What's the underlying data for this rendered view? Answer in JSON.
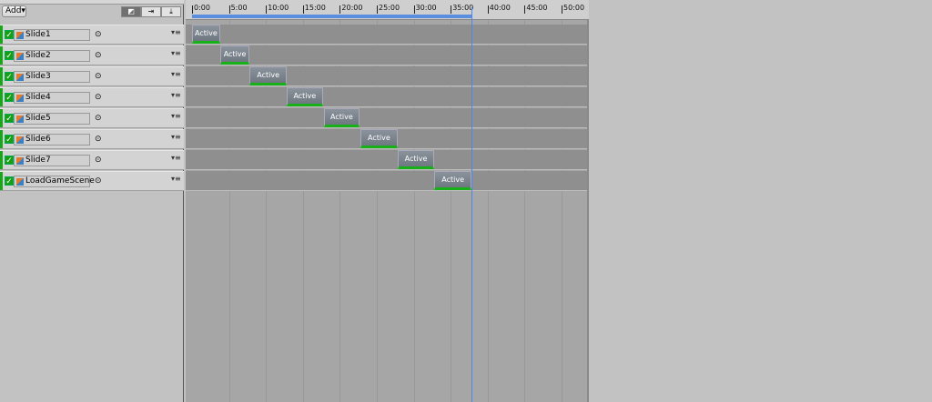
{
  "toolbar": {
    "add_label": "Add▾",
    "modes": [
      "◩",
      "⇥",
      "⤓"
    ]
  },
  "tracks": [
    {
      "name": "Slide1",
      "clip": "Active",
      "start": 0,
      "end": 3.8
    },
    {
      "name": "Slide2",
      "clip": "Active",
      "start": 3.8,
      "end": 7.8
    },
    {
      "name": "Slide3",
      "clip": "Active",
      "start": 7.8,
      "end": 12.8
    },
    {
      "name": "Slide4",
      "clip": "Active",
      "start": 12.8,
      "end": 17.7
    },
    {
      "name": "Slide5",
      "clip": "Active",
      "start": 17.8,
      "end": 22.7
    },
    {
      "name": "Slide6",
      "clip": "Active",
      "start": 22.8,
      "end": 27.8
    },
    {
      "name": "Slide7",
      "clip": "Active",
      "start": 27.8,
      "end": 32.8
    },
    {
      "name": "LoadGameScene",
      "clip": "Active",
      "start": 32.8,
      "end": 37.8
    }
  ],
  "ruler": {
    "labels": [
      "0:00",
      "5:00",
      "10:00",
      "15:00",
      "20:00",
      "25:00",
      "30:00",
      "35:00",
      "40:00",
      "45:00",
      "50:00"
    ],
    "step": 5
  },
  "playhead_time": 37.8,
  "colors": {
    "accent": "#4d86e8",
    "active": "#18b018"
  }
}
